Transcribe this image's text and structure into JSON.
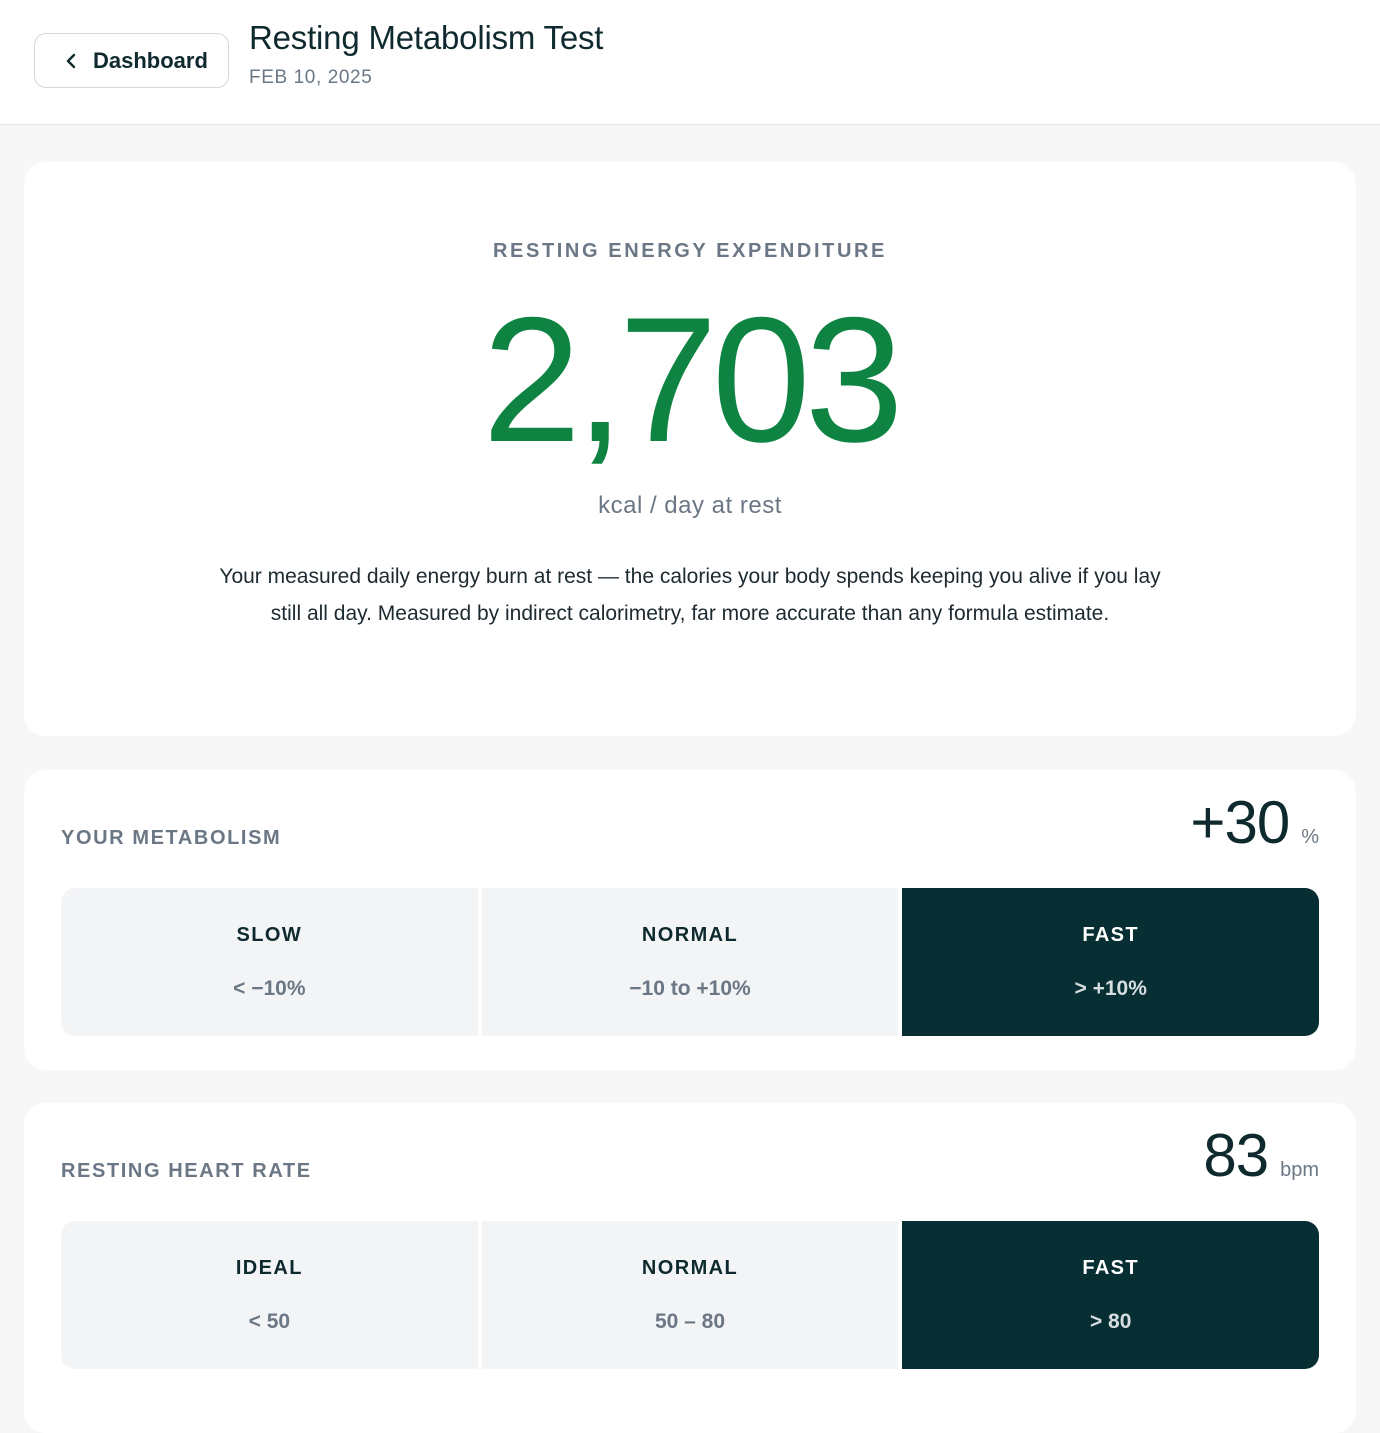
{
  "header": {
    "back_label": "Dashboard",
    "title": "Resting Metabolism Test",
    "date": "FEB 10, 2025"
  },
  "ree": {
    "label": "RESTING ENERGY EXPENDITURE",
    "value": "2,703",
    "unit": "kcal / day at rest",
    "description": "Your measured daily energy burn at rest — the calories your body spends keeping you alive if you lay still all day. Measured by indirect calorimetry, far more accurate than any formula estimate.",
    "value_color": "#0f8442"
  },
  "metabolism": {
    "label": "YOUR METABOLISM",
    "value": "+30",
    "unit": "%",
    "segments": [
      {
        "name": "SLOW",
        "range": "< −10%"
      },
      {
        "name": "NORMAL",
        "range": "−10 to +10%"
      },
      {
        "name": "FAST",
        "range": "> +10%"
      }
    ],
    "active_segment": "FAST"
  },
  "heart_rate": {
    "label": "RESTING HEART RATE",
    "value": "83",
    "unit": "bpm",
    "segments": [
      {
        "name": "IDEAL",
        "range": "< 50"
      },
      {
        "name": "NORMAL",
        "range": "50 – 80"
      },
      {
        "name": "FAST",
        "range": "> 80"
      }
    ],
    "active_segment": "FAST"
  },
  "colors": {
    "accent_green": "#0f8442",
    "active_segment_bg": "#062e33",
    "segment_bg": "#f3f4f6"
  },
  "icons": {
    "back": "chevron-left-icon"
  }
}
